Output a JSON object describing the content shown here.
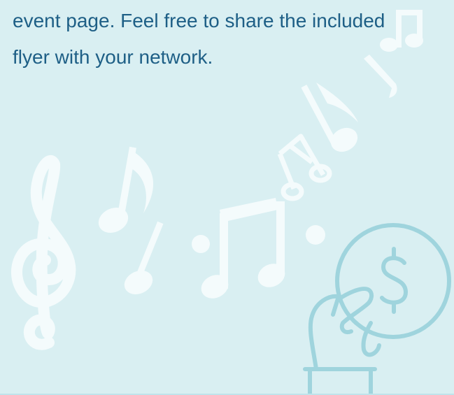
{
  "message": {
    "line1": "event page. Feel free to share the included",
    "line2": "flyer with your network."
  },
  "icons": {
    "treble_clef": "treble-clef-icon",
    "music_notes": "music-notes-icon",
    "donation_hand": "hand-holding-dollar-coin-icon"
  },
  "colors": {
    "background": "#d9eff2",
    "text": "#1e5f86",
    "notes": "#f4fbfc",
    "accent": "#9fd4dd"
  }
}
